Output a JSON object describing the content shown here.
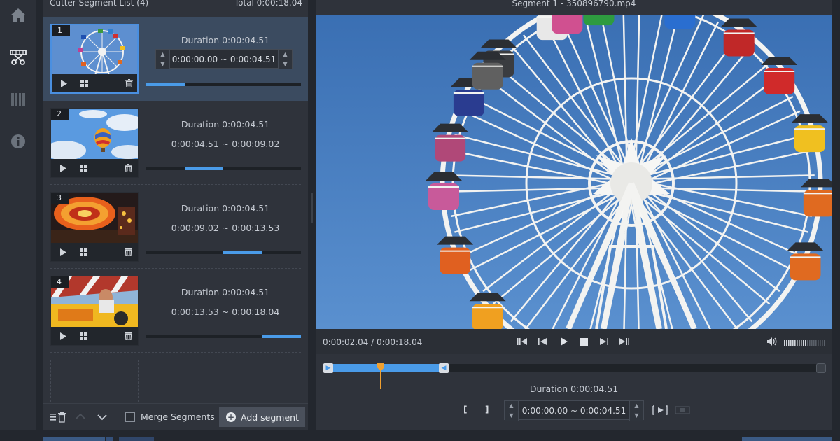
{
  "segment_list": {
    "title": "Cutter Segment List (4)",
    "total": "Total 0:00:18.04",
    "segments": [
      {
        "num": "1",
        "duration": "Duration 0:00:04.51",
        "start": "0:00:00.00",
        "sep": "~",
        "end": "0:00:04.51",
        "progress_start": 0.0,
        "progress_end": 0.25
      },
      {
        "num": "2",
        "duration": "Duration 0:00:04.51",
        "start": "0:00:04.51",
        "sep": "~",
        "end": "0:00:09.02",
        "progress_start": 0.25,
        "progress_end": 0.5
      },
      {
        "num": "3",
        "duration": "Duration 0:00:04.51",
        "start": "0:00:09.02",
        "sep": "~",
        "end": "0:00:13.53",
        "progress_start": 0.5,
        "progress_end": 0.75
      },
      {
        "num": "4",
        "duration": "Duration 0:00:04.51",
        "start": "0:00:13.53",
        "sep": "~",
        "end": "0:00:18.04",
        "progress_start": 0.75,
        "progress_end": 1.0
      }
    ],
    "merge_label": "Merge Segments",
    "add_label": "Add segment"
  },
  "player": {
    "title": "Segment 1 - 350896790.mp4",
    "current_time": "0:00:02.04",
    "time_sep": "/",
    "total_time": "0:00:18.04",
    "selection_fraction": 0.25,
    "playhead_fraction": 0.113,
    "duration": "Duration 0:00:04.51",
    "range_start": "0:00:00.00",
    "range_sep": "~",
    "range_end": "0:00:04.51"
  },
  "icons": [
    "home-icon",
    "cutter-icon",
    "film-icon",
    "info-icon",
    "play-icon",
    "grid-icon",
    "trash-icon",
    "volume-icon"
  ],
  "colors": {
    "accent": "#4a9be8",
    "playhead": "#f0a030",
    "active_segment": "#3b4b60"
  }
}
